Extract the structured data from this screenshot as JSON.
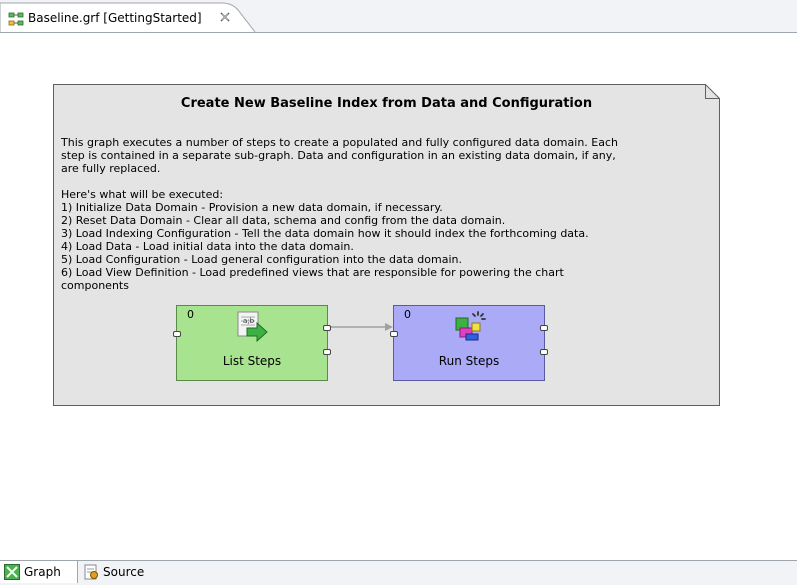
{
  "editor_tab": {
    "title": "Baseline.grf [GettingStarted]",
    "close_glyph": "✕",
    "icon": "graph-file-icon"
  },
  "note": {
    "title": "Create New Baseline Index from Data and Configuration",
    "lines": [
      "This graph executes a number of steps to create a populated and fully configured data domain. Each",
      "step is contained in a separate sub-graph. Data and configuration in an existing data domain, if any,",
      "are fully replaced.",
      "",
      "Here's what will be executed:",
      "1) Initialize Data Domain - Provision a new data domain, if necessary.",
      "2) Reset Data Domain - Clear all data, schema and config from the data domain.",
      "3) Load Indexing Configuration - Tell the data domain how it should index the forthcoming data.",
      "4) Load Data - Load initial data into the data domain.",
      "5) Load Configuration - Load general configuration into the data domain.",
      "6) Load View Definition - Load predefined views that are responsible for powering the chart",
      "components"
    ]
  },
  "components": {
    "list_steps": {
      "label": "List Steps",
      "count": "0",
      "color": "#a8e48f",
      "icon": "list-steps-icon"
    },
    "run_steps": {
      "label": "Run Steps",
      "count": "0",
      "color": "#aaaaf7",
      "icon": "run-steps-icon"
    }
  },
  "bottom_tabs": [
    {
      "label": "Graph",
      "icon": "graph-tab-icon",
      "active": true
    },
    {
      "label": "Source",
      "icon": "source-tab-icon",
      "active": false
    }
  ]
}
